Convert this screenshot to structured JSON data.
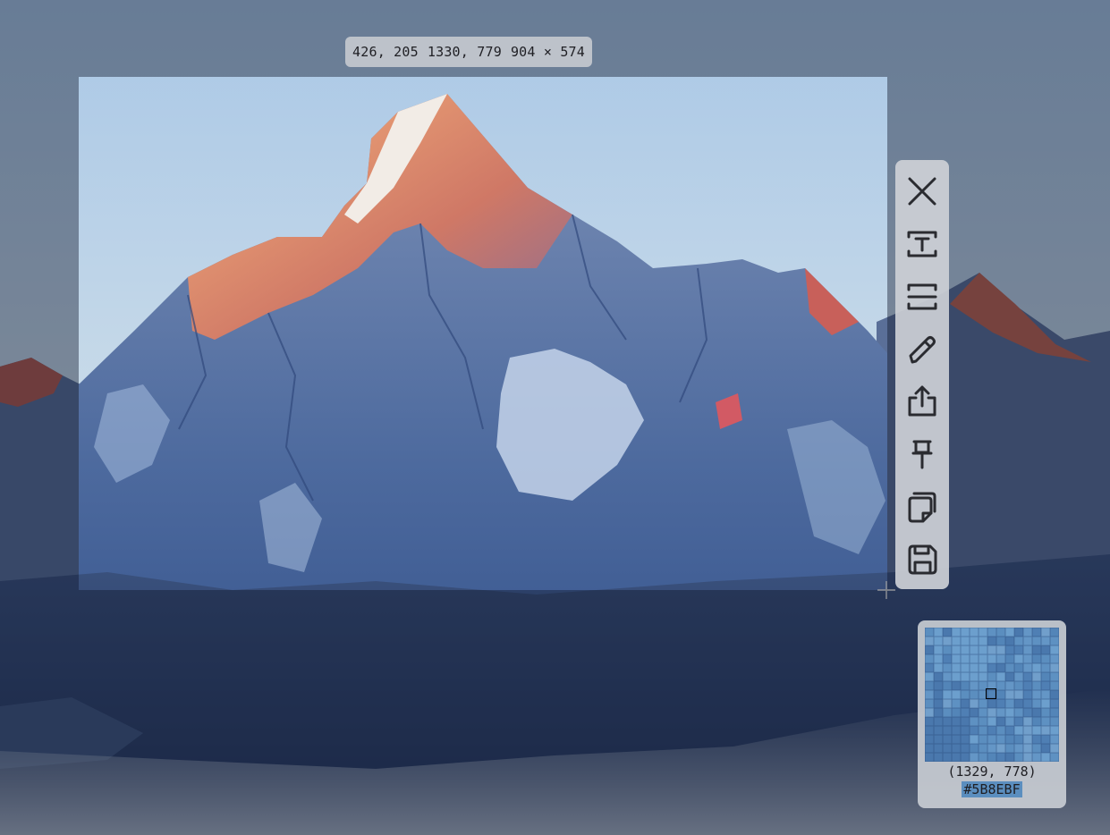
{
  "selection": {
    "start": "426, 205",
    "end": "1330, 779",
    "size": "904 × 574"
  },
  "toolbar": {
    "items": [
      {
        "name": "close-button",
        "icon": "close-icon",
        "tooltip": "Close"
      },
      {
        "name": "ocr-text-button",
        "icon": "text-recognition-icon",
        "tooltip": "Recognize text"
      },
      {
        "name": "scroll-capture-button",
        "icon": "scroll-capture-icon",
        "tooltip": "Scrolling capture"
      },
      {
        "name": "annotate-button",
        "icon": "pencil-icon",
        "tooltip": "Annotate"
      },
      {
        "name": "share-button",
        "icon": "share-icon",
        "tooltip": "Share"
      },
      {
        "name": "pin-button",
        "icon": "pin-icon",
        "tooltip": "Pin"
      },
      {
        "name": "copy-button",
        "icon": "copy-icon",
        "tooltip": "Copy"
      },
      {
        "name": "save-button",
        "icon": "save-icon",
        "tooltip": "Save"
      }
    ]
  },
  "magnifier": {
    "cursor_position": "(1329, 778)",
    "color_hex": "#5B8EBF",
    "highlight_color": "#5B8EBF"
  }
}
